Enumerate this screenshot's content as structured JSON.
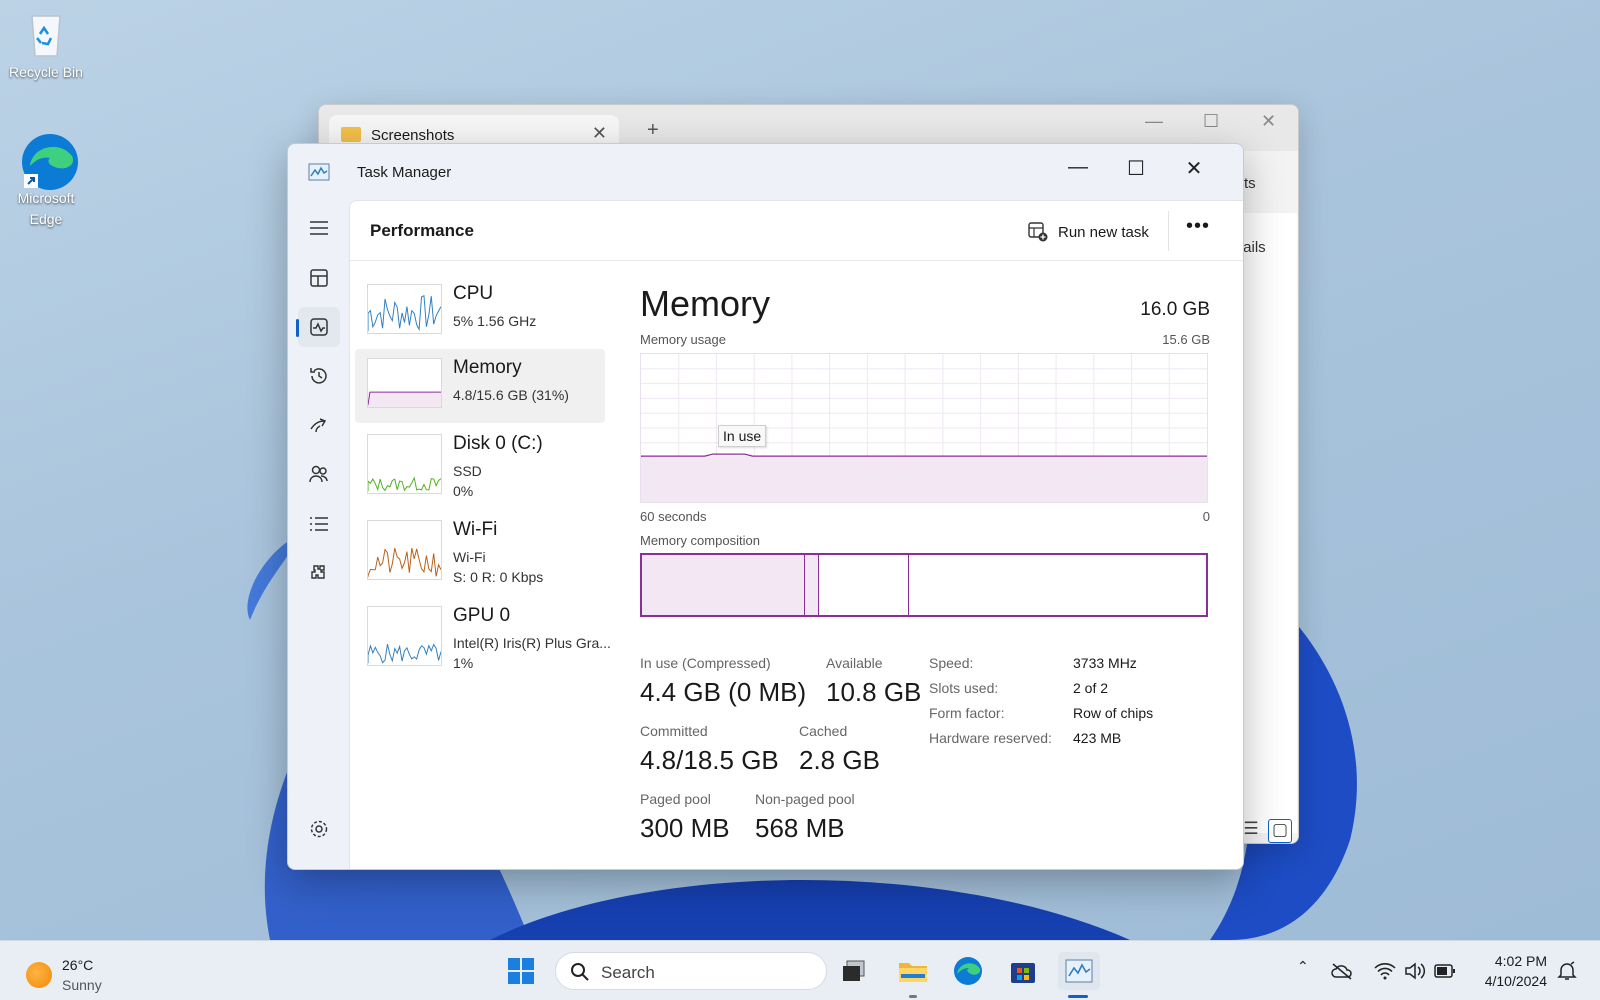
{
  "desktop": {
    "icons": [
      {
        "label": "Recycle Bin"
      },
      {
        "label": "Microsoft Edge"
      }
    ]
  },
  "explorer": {
    "tab_label": "Screenshots",
    "tab_close": "✕",
    "new_tab": "+",
    "minimize": "—",
    "maximize": "☐",
    "close": "✕",
    "partial_text_1": "ts",
    "partial_text_2": "tails"
  },
  "taskmanager": {
    "title": "Task Manager",
    "window": {
      "minimize": "—",
      "maximize": "☐",
      "close": "✕"
    },
    "nav": {
      "items": [
        "hamburger-icon",
        "processes-icon",
        "performance-icon",
        "app-history-icon",
        "startup-apps-icon",
        "users-icon",
        "details-icon",
        "services-icon"
      ],
      "settings": "settings-icon",
      "active": "performance-icon"
    },
    "header": {
      "title": "Performance",
      "run_new_task": "Run new task",
      "more": "•••"
    },
    "resources": [
      {
        "name": "CPU",
        "lines": [
          "5%  1.56 GHz"
        ],
        "color": "#2f7dc0"
      },
      {
        "name": "Memory",
        "lines": [
          "4.8/15.6 GB (31%)"
        ],
        "color": "#8b2f98"
      },
      {
        "name": "Disk 0 (C:)",
        "lines": [
          "SSD",
          "0%"
        ],
        "color": "#4caf1e"
      },
      {
        "name": "Wi-Fi",
        "lines": [
          "Wi-Fi",
          "S: 0  R: 0 Kbps"
        ],
        "color": "#b85f14"
      },
      {
        "name": "GPU 0",
        "lines": [
          "Intel(R) Iris(R) Plus Gra...",
          "1%"
        ],
        "color": "#2f7dc0"
      }
    ],
    "detail": {
      "title": "Memory",
      "total": "16.0 GB",
      "usage_label": "Memory usage",
      "usage_max": "15.6 GB",
      "axis_left": "60 seconds",
      "axis_right": "0",
      "tooltip": "In use",
      "in_use_fraction": 0.31,
      "composition_label": "Memory composition",
      "stats": {
        "in_use_label": "In use (Compressed)",
        "in_use_value": "4.4 GB (0 MB)",
        "available_label": "Available",
        "available_value": "10.8 GB",
        "committed_label": "Committed",
        "committed_value": "4.8/18.5 GB",
        "cached_label": "Cached",
        "cached_value": "2.8 GB",
        "paged_label": "Paged pool",
        "paged_value": "300 MB",
        "nonpaged_label": "Non-paged pool",
        "nonpaged_value": "568 MB"
      },
      "specs": [
        {
          "key": "Speed:",
          "value": "3733 MHz"
        },
        {
          "key": "Slots used:",
          "value": "2 of 2"
        },
        {
          "key": "Form factor:",
          "value": "Row of chips"
        },
        {
          "key": "Hardware reserved:",
          "value": "423 MB"
        }
      ]
    }
  },
  "taskbar": {
    "weather_temp": "26°C",
    "weather_desc": "Sunny",
    "search_label": "Search",
    "time": "4:02 PM",
    "date": "4/10/2024"
  },
  "colors": {
    "memory": "#8b2f98",
    "memory_fill": "#f2e7f3",
    "accent": "#0f63c8"
  }
}
